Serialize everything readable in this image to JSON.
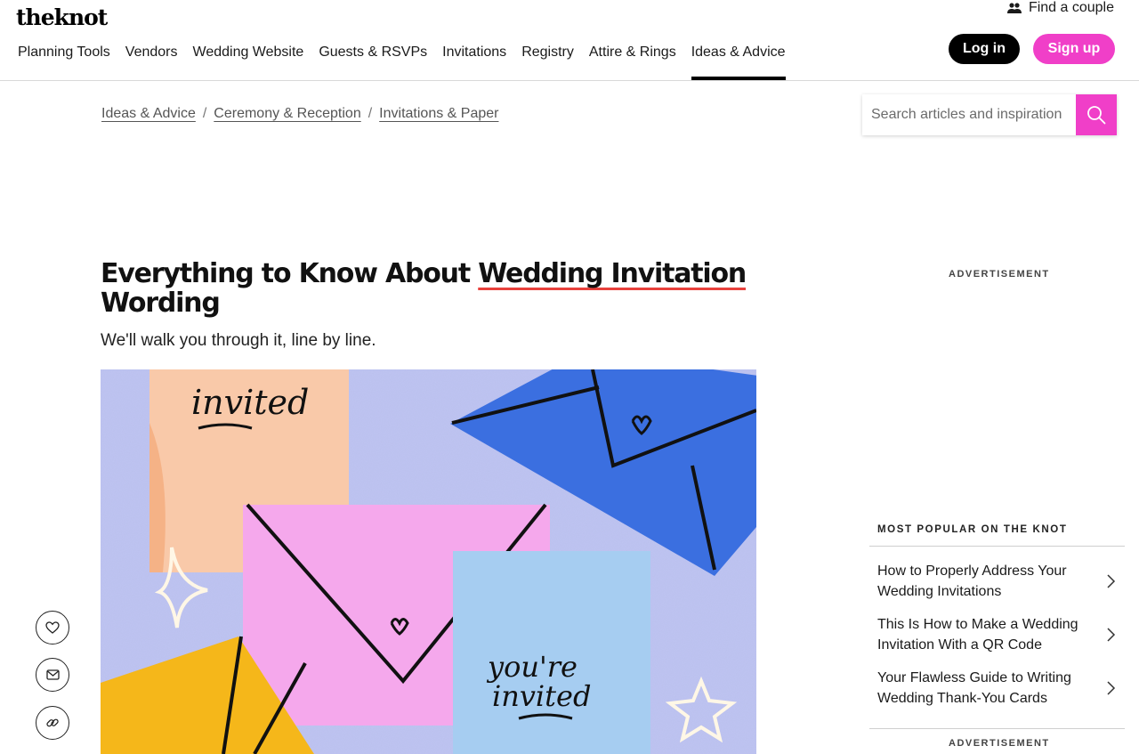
{
  "header": {
    "logo": "theknot",
    "find_couple": "Find a couple",
    "nav": [
      {
        "label": "Planning Tools"
      },
      {
        "label": "Vendors"
      },
      {
        "label": "Wedding Website"
      },
      {
        "label": "Guests & RSVPs"
      },
      {
        "label": "Invitations"
      },
      {
        "label": "Registry"
      },
      {
        "label": "Attire & Rings"
      },
      {
        "label": "Ideas & Advice"
      }
    ],
    "active_nav": "Ideas & Advice",
    "login_label": "Log in",
    "signup_label": "Sign up"
  },
  "breadcrumb": {
    "items": [
      "Ideas & Advice",
      "Ceremony & Reception",
      "Invitations & Paper"
    ],
    "separator": "/"
  },
  "search": {
    "placeholder": "Search articles and inspiration"
  },
  "article": {
    "title_part1": "Everything to Know About ",
    "title_highlight": "Wedding Invitation",
    "title_part2": " Wording",
    "subtitle": "We'll walk you through it, line by line.",
    "hero_text_1": "invited",
    "hero_text_2a": "you're",
    "hero_text_2b": "invited"
  },
  "sidebar": {
    "ad_label_top": "ADVERTISEMENT",
    "popular_heading": "MOST POPULAR ON THE KNOT",
    "popular": [
      {
        "title": "How to Properly Address Your Wedding Invitations"
      },
      {
        "title": "This Is How to Make a Wedding Invitation With a QR Code"
      },
      {
        "title": "Your Flawless Guide to Writing Wedding Thank-You Cards"
      }
    ],
    "ad_label_bottom": "ADVERTISEMENT"
  },
  "share": {
    "icons": [
      "heart-icon",
      "mail-icon",
      "link-icon"
    ]
  },
  "colors": {
    "brand_pink": "#f03fc8",
    "title_underline": "#e8413c",
    "hero_background": "#c7c6f2",
    "envelope_blue": "#3b6fe0",
    "card_peach": "#f9c9a9",
    "envelope_pink": "#f5a8ec",
    "card_lightblue": "#a6cdf1",
    "accent_yellow": "#f5b71a"
  }
}
